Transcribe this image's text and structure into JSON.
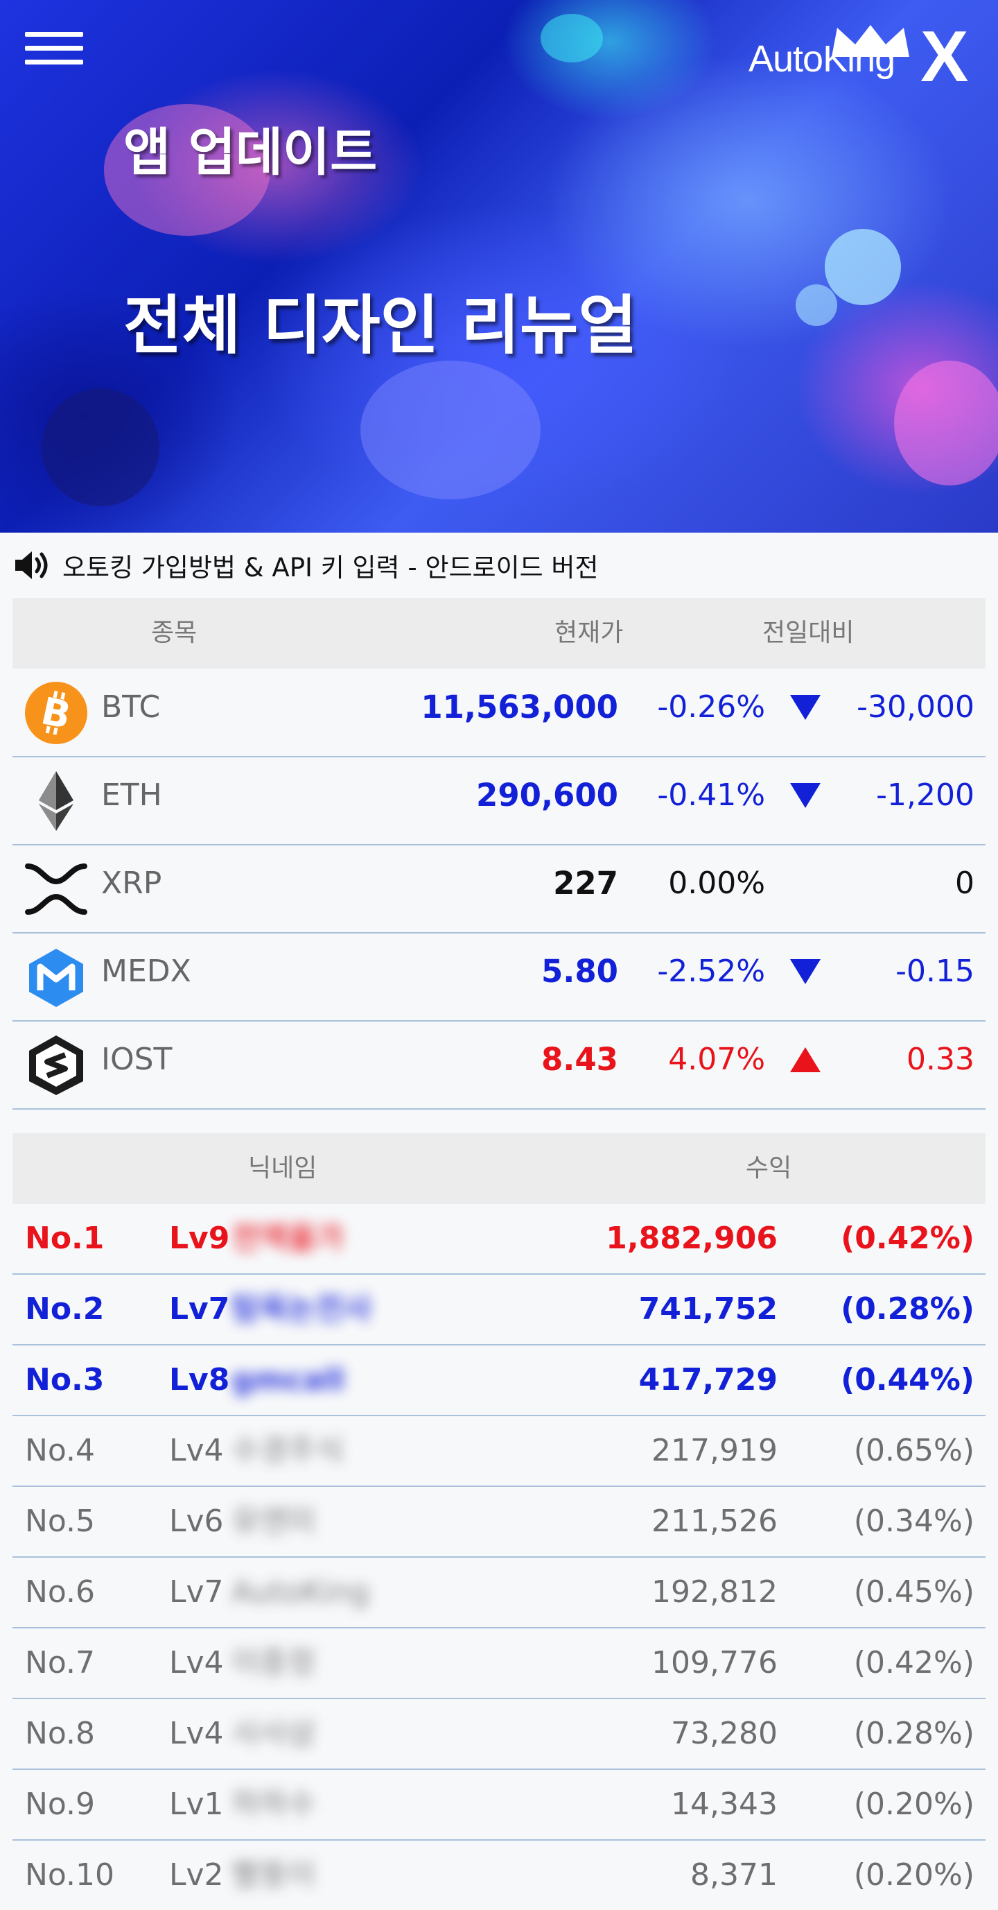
{
  "banner": {
    "title_line1": "앱 업데이트",
    "title_line2": "전체 디자인 리뉴얼",
    "logo_text": "AutoKing",
    "logo_x": "X"
  },
  "notice": {
    "text": "오토킹 가입방법 & API 키 입력 - 안드로이드 버전"
  },
  "price_table": {
    "headers": {
      "symbol": "종목",
      "price": "현재가",
      "change": "전일대비"
    },
    "rows": [
      {
        "symbol": "BTC",
        "price": "11,563,000",
        "pct": "-0.26%",
        "direction": "down",
        "diff": "-30,000",
        "icon": "bitcoin-icon"
      },
      {
        "symbol": "ETH",
        "price": "290,600",
        "pct": "-0.41%",
        "direction": "down",
        "diff": "-1,200",
        "icon": "ethereum-icon"
      },
      {
        "symbol": "XRP",
        "price": "227",
        "pct": "0.00%",
        "direction": "flat",
        "diff": "0",
        "icon": "ripple-icon"
      },
      {
        "symbol": "MEDX",
        "price": "5.80",
        "pct": "-2.52%",
        "direction": "down",
        "diff": "-0.15",
        "icon": "medx-icon"
      },
      {
        "symbol": "IOST",
        "price": "8.43",
        "pct": "4.07%",
        "direction": "up",
        "diff": "0.33",
        "icon": "iost-icon"
      }
    ]
  },
  "ranking": {
    "headers": {
      "nickname": "닉네임",
      "profit": "수익"
    },
    "rows": [
      {
        "no": "No.1",
        "lv": "Lv9",
        "nick": "전액올가",
        "profit": "1,882,906",
        "ratio": "(0.42%)"
      },
      {
        "no": "No.2",
        "lv": "Lv7",
        "nick": "탐욕논전사",
        "profit": "741,752",
        "ratio": "(0.28%)"
      },
      {
        "no": "No.3",
        "lv": "Lv8",
        "nick": "gmcall",
        "profit": "417,729",
        "ratio": "(0.44%)"
      },
      {
        "no": "No.4",
        "lv": "Lv4",
        "nick": "수경주식",
        "profit": "217,919",
        "ratio": "(0.65%)"
      },
      {
        "no": "No.5",
        "lv": "Lv6",
        "nick": "유엔미",
        "profit": "211,526",
        "ratio": "(0.34%)"
      },
      {
        "no": "No.6",
        "lv": "Lv7",
        "nick": "AutoKing",
        "profit": "192,812",
        "ratio": "(0.45%)"
      },
      {
        "no": "No.7",
        "lv": "Lv4",
        "nick": "이중정",
        "profit": "109,776",
        "ratio": "(0.42%)"
      },
      {
        "no": "No.8",
        "lv": "Lv4",
        "nick": "사사삼",
        "profit": "73,280",
        "ratio": "(0.28%)"
      },
      {
        "no": "No.9",
        "lv": "Lv1",
        "nick": "하하수",
        "profit": "14,343",
        "ratio": "(0.20%)"
      },
      {
        "no": "No.10",
        "lv": "Lv2",
        "nick": "빨뚱이",
        "profit": "8,371",
        "ratio": "(0.20%)"
      }
    ]
  },
  "colors": {
    "up": "#e8131b",
    "down": "#1221d8",
    "flat": "#111111",
    "row_border": "#a9c1dc",
    "header_bg": "#ececec"
  }
}
